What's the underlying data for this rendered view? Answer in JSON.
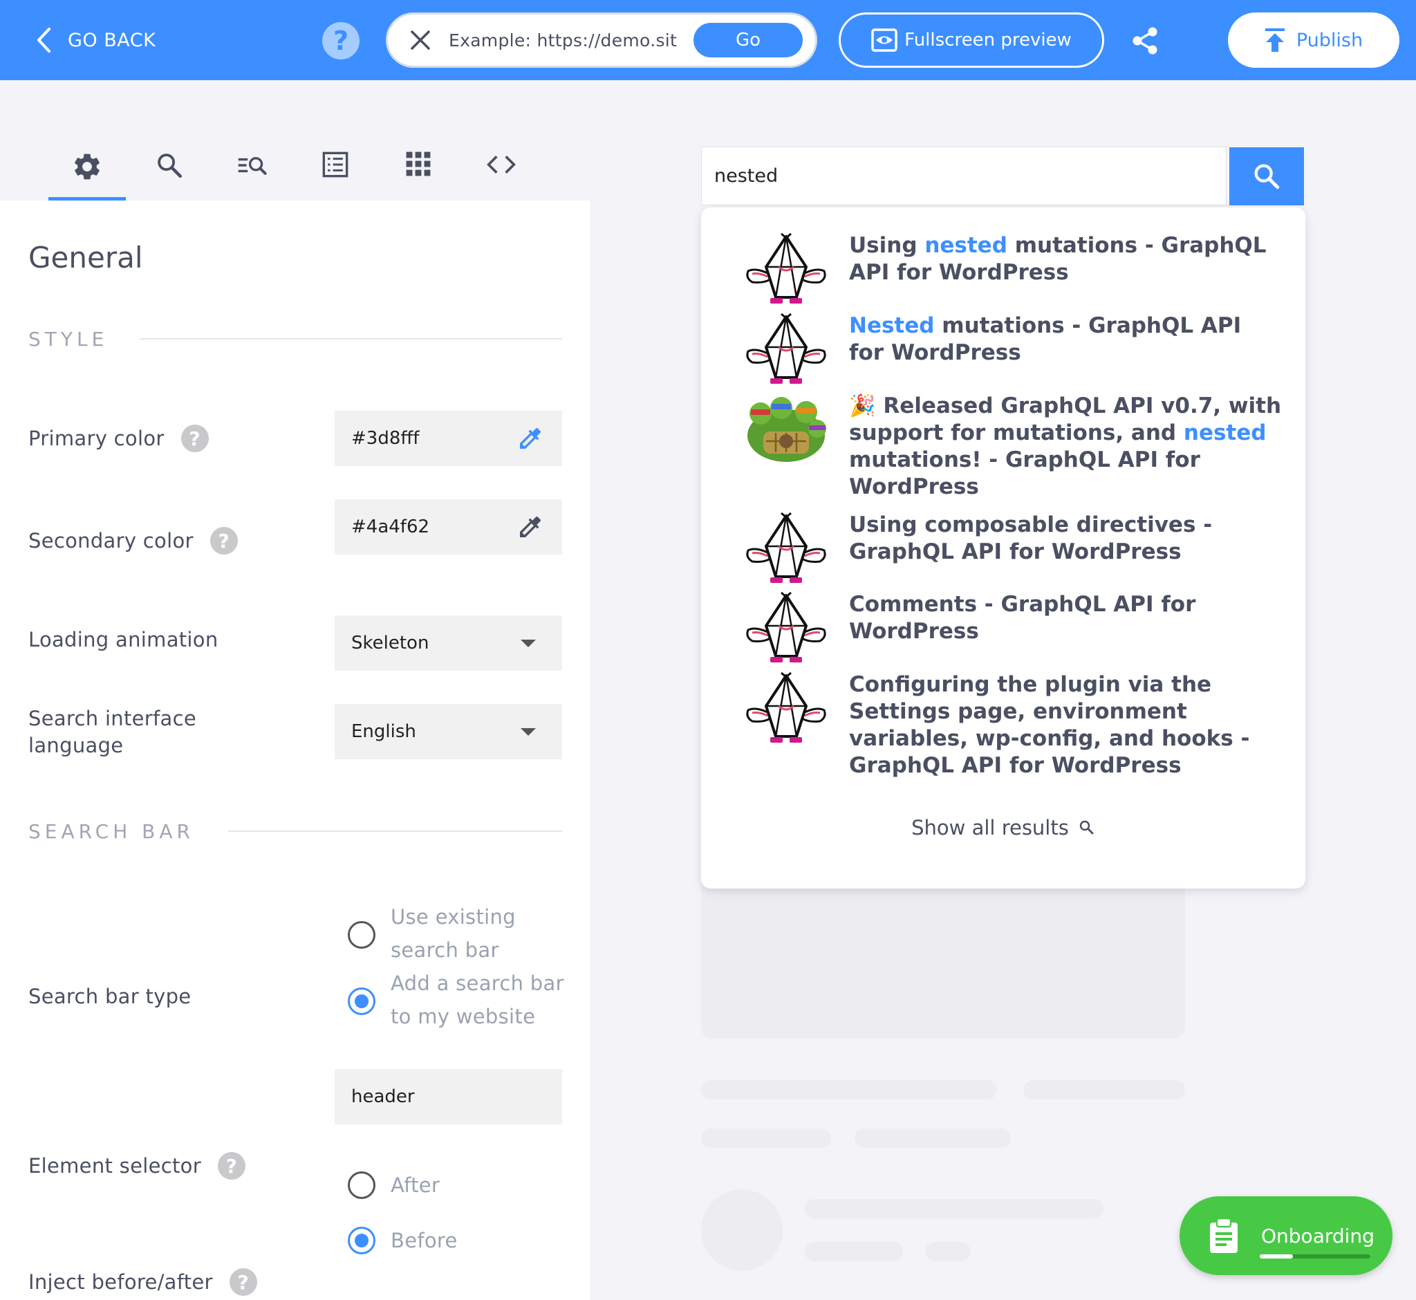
{
  "topbar": {
    "go_back_label": "GO BACK",
    "help_symbol": "?",
    "url_placeholder": "Example: https://demo.sit",
    "go_label": "Go",
    "fullscreen_label": "Fullscreen preview",
    "publish_label": "Publish",
    "icons": [
      "chevron-left-icon",
      "help-icon",
      "close-icon",
      "eye-icon",
      "share-icon",
      "upload-icon"
    ]
  },
  "tabs": [
    {
      "icon": "gear-icon",
      "active": true
    },
    {
      "icon": "search-icon",
      "active": false
    },
    {
      "icon": "list-search-icon",
      "active": false
    },
    {
      "icon": "list-icon",
      "active": false
    },
    {
      "icon": "grid-icon",
      "active": false
    },
    {
      "icon": "code-icon",
      "active": false
    }
  ],
  "panel": {
    "title": "General",
    "style_section": "STYLE",
    "search_bar_section": "SEARCH BAR",
    "primary_color_label": "Primary color",
    "primary_color_value": "#3d8fff",
    "secondary_color_label": "Secondary color",
    "secondary_color_value": "#4a4f62",
    "loading_animation_label": "Loading animation",
    "loading_animation_value": "Skeleton",
    "language_label": "Search interface language",
    "language_value": "English",
    "search_bar_type_label": "Search bar type",
    "search_bar_type_options": [
      "Use existing search bar",
      "Add a search bar to my website"
    ],
    "search_bar_type_selected": 1,
    "element_selector_label": "Element selector",
    "element_selector_value": "header",
    "inject_label": "Inject before/after",
    "inject_options": [
      "After",
      "Before"
    ],
    "inject_selected": 1
  },
  "preview": {
    "search_query": "nested",
    "results": [
      {
        "prefix": "Using ",
        "highlight": "nested",
        "suffix": " mutations - GraphQL API for WordPress",
        "thumb": "graphql-mascot"
      },
      {
        "prefix": "",
        "highlight": "Nested",
        "suffix": " mutations - GraphQL API for WordPress",
        "thumb": "graphql-mascot"
      },
      {
        "prefix": "🎉 Released GraphQL API v0.7, with support for mutations, and ",
        "highlight": "nested",
        "suffix": " mutations! - GraphQL API for WordPress",
        "thumb": "turtles-image"
      },
      {
        "prefix": "Using composable directives - GraphQL API for WordPress",
        "highlight": "",
        "suffix": "",
        "thumb": "graphql-mascot"
      },
      {
        "prefix": "Comments - GraphQL API for WordPress",
        "highlight": "",
        "suffix": "",
        "thumb": "graphql-mascot"
      },
      {
        "prefix": "Configuring the plugin via the Settings page, environment variables, wp-config, and hooks - GraphQL API for WordPress",
        "highlight": "",
        "suffix": "",
        "thumb": "graphql-mascot"
      }
    ],
    "show_all_label": "Show all results"
  },
  "onboarding": {
    "label": "Onboarding",
    "progress": 0.3
  },
  "colors": {
    "accent": "#3d8fff",
    "secondary": "#4a4f62",
    "onboarding": "#48c946"
  }
}
